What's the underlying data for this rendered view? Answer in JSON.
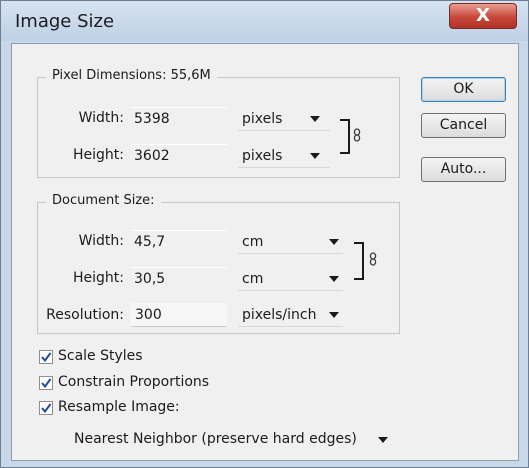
{
  "window": {
    "title": "Image Size",
    "close_label": "X"
  },
  "pixel_dimensions": {
    "legend": "Pixel Dimensions: 55,6M",
    "width_label": "Width:",
    "width_value": "5398",
    "width_unit": "pixels",
    "height_label": "Height:",
    "height_value": "3602",
    "height_unit": "pixels"
  },
  "document_size": {
    "legend": "Document Size:",
    "width_label": "Width:",
    "width_value": "45,7",
    "width_unit": "cm",
    "height_label": "Height:",
    "height_value": "30,5",
    "height_unit": "cm",
    "resolution_label": "Resolution:",
    "resolution_value": "300",
    "resolution_unit": "pixels/inch"
  },
  "buttons": {
    "ok": "OK",
    "cancel": "Cancel",
    "auto": "Auto..."
  },
  "options": {
    "scale_styles": {
      "label": "Scale Styles",
      "checked": true
    },
    "constrain_proportions": {
      "label": "Constrain Proportions",
      "checked": true
    },
    "resample_image": {
      "label": "Resample Image:",
      "checked": true
    },
    "resample_method": "Nearest Neighbor (preserve hard edges)"
  },
  "colors": {
    "title_bar": "#c9d8e9",
    "close_button": "#c7483a",
    "dialog_background": "#f0f0f0",
    "checkmark": "#1f4e9a"
  }
}
